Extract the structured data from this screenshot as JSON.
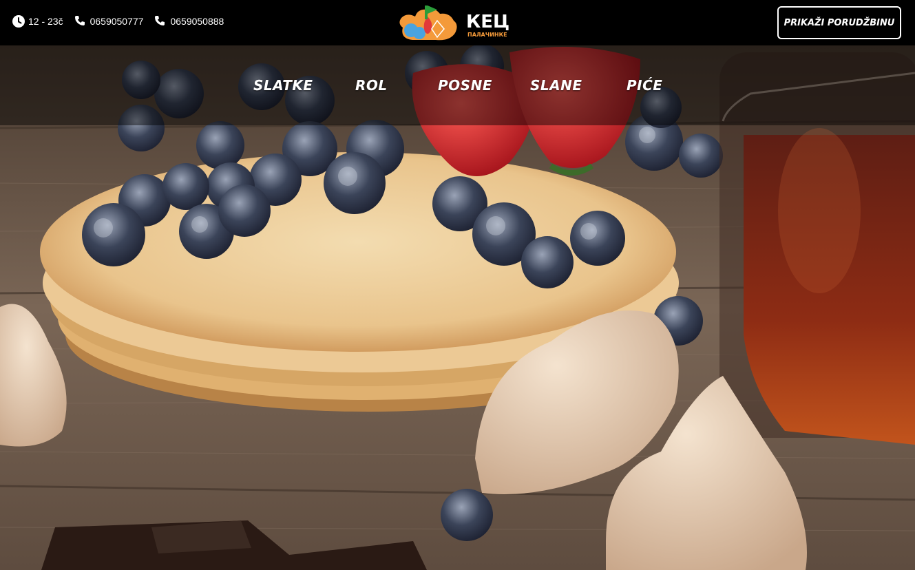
{
  "header": {
    "hours": "12 - 23č",
    "phone_1": "0659050777",
    "phone_2": "0659050888",
    "logo": {
      "brand": "КЕЦ",
      "tagline": "ПАЛАЧИНКЕ"
    },
    "order_button_label": "PRIKAŽI PORUDŽBINU",
    "icons": [
      "clock-icon",
      "phone-icon",
      "phone-icon"
    ]
  },
  "nav": {
    "items": [
      {
        "label": "SLATKE"
      },
      {
        "label": "ROL"
      },
      {
        "label": "POSNE"
      },
      {
        "label": "SLANE"
      },
      {
        "label": "PIĆE"
      }
    ]
  },
  "colors": {
    "topbar": "#000000",
    "nav_text": "#ffffff"
  }
}
